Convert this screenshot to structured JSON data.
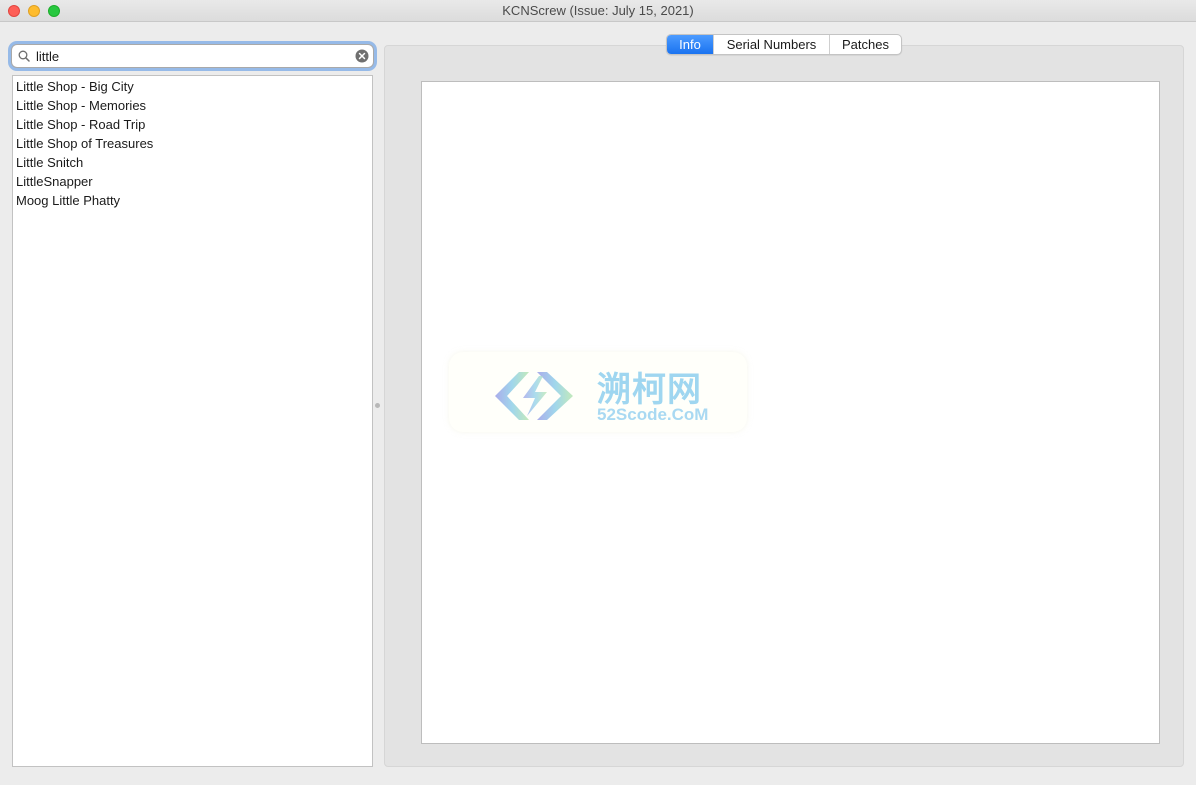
{
  "window": {
    "title": "KCNScrew (Issue: July 15, 2021)"
  },
  "search": {
    "value": "little"
  },
  "list": {
    "items": [
      "Little Shop - Big City",
      "Little Shop - Memories",
      "Little Shop - Road Trip",
      "Little Shop of Treasures",
      "Little Snitch",
      "LittleSnapper",
      "Moog Little Phatty"
    ]
  },
  "tabs": [
    {
      "label": "Info",
      "active": true
    },
    {
      "label": "Serial Numbers",
      "active": false
    },
    {
      "label": "Patches",
      "active": false
    }
  ],
  "watermark": {
    "title": "溯柯网",
    "subtitle": "52Scode.CoM"
  },
  "colors": {
    "accent": "#1a73f0",
    "close": "#fe5f57",
    "minimize": "#febc2e",
    "maximize": "#28c840"
  }
}
